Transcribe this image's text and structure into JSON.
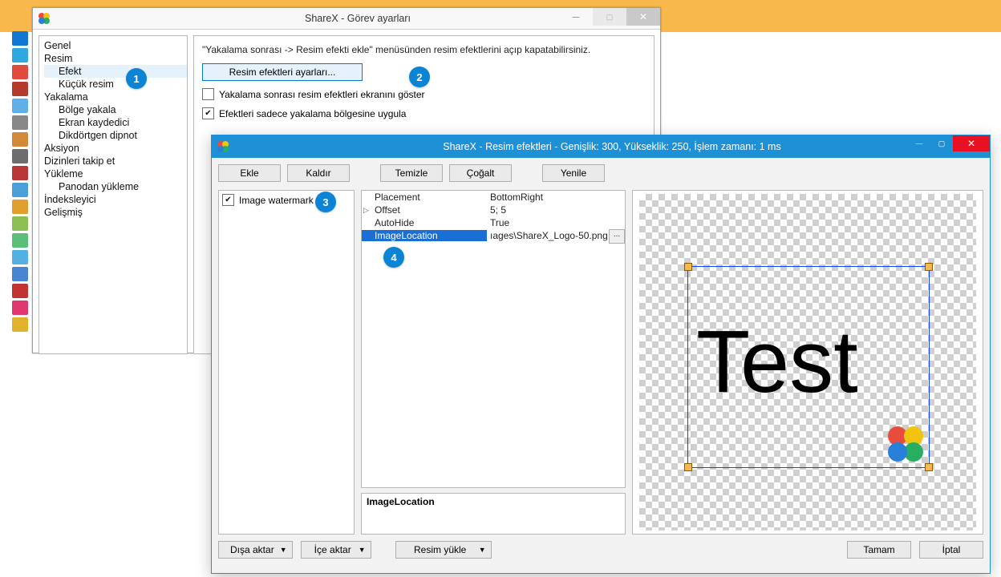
{
  "callouts": {
    "c1": "1",
    "c2": "2",
    "c3": "3",
    "c4": "4"
  },
  "back_window": {
    "title": "ShareX - Görev ayarları",
    "nav_items": [
      {
        "label": "Genel",
        "child": false,
        "selected": false
      },
      {
        "label": "Resim",
        "child": false,
        "selected": false
      },
      {
        "label": "Efekt",
        "child": true,
        "selected": true
      },
      {
        "label": "Küçük resim",
        "child": true,
        "selected": false
      },
      {
        "label": "Yakalama",
        "child": false,
        "selected": false
      },
      {
        "label": "Bölge yakala",
        "child": true,
        "selected": false
      },
      {
        "label": "Ekran kaydedici",
        "child": true,
        "selected": false
      },
      {
        "label": "Dikdörtgen dipnot",
        "child": true,
        "selected": false
      },
      {
        "label": "Aksiyon",
        "child": false,
        "selected": false
      },
      {
        "label": "Dizinleri takip et",
        "child": false,
        "selected": false
      },
      {
        "label": "Yükleme",
        "child": false,
        "selected": false
      },
      {
        "label": "Panodan yükleme",
        "child": true,
        "selected": false
      },
      {
        "label": "İndeksleyici",
        "child": false,
        "selected": false
      },
      {
        "label": "Gelişmiş",
        "child": false,
        "selected": false
      }
    ],
    "info_text": "\"Yakalama sonrası -> Resim efekti ekle\" menüsünden resim efektlerini açıp kapatabilirsiniz.",
    "settings_btn": "Resim efektleri ayarları...",
    "chk1": {
      "label": "Yakalama sonrası resim efektleri ekranını göster",
      "checked": false
    },
    "chk2": {
      "label": "Efektleri sadece yakalama bölgesine uygula",
      "checked": true
    }
  },
  "front_window": {
    "title": "ShareX - Resim efektleri - Genişlik: 300, Yükseklik: 250, İşlem zamanı: 1 ms",
    "toolbar": {
      "add": "Ekle",
      "remove": "Kaldır",
      "clear": "Temizle",
      "dup": "Çoğalt",
      "refresh": "Yenile"
    },
    "effect_item": {
      "label": "Image watermark",
      "checked": true
    },
    "props": {
      "rows": [
        {
          "name": "Placement",
          "value": "BottomRight",
          "selected": false,
          "expander": false
        },
        {
          "name": "Offset",
          "value": "5; 5",
          "selected": false,
          "expander": true
        },
        {
          "name": "AutoHide",
          "value": "True",
          "selected": false,
          "expander": false
        },
        {
          "name": "ImageLocation",
          "value": "ıages\\ShareX_Logo-50.png",
          "selected": true,
          "expander": false,
          "ell": true
        }
      ],
      "help_name": "ImageLocation"
    },
    "preview_text": "Test",
    "footer": {
      "export": "Dışa aktar",
      "import": "İçe aktar",
      "load_image": "Resim yükle",
      "ok": "Tamam",
      "cancel": "İptal"
    }
  }
}
